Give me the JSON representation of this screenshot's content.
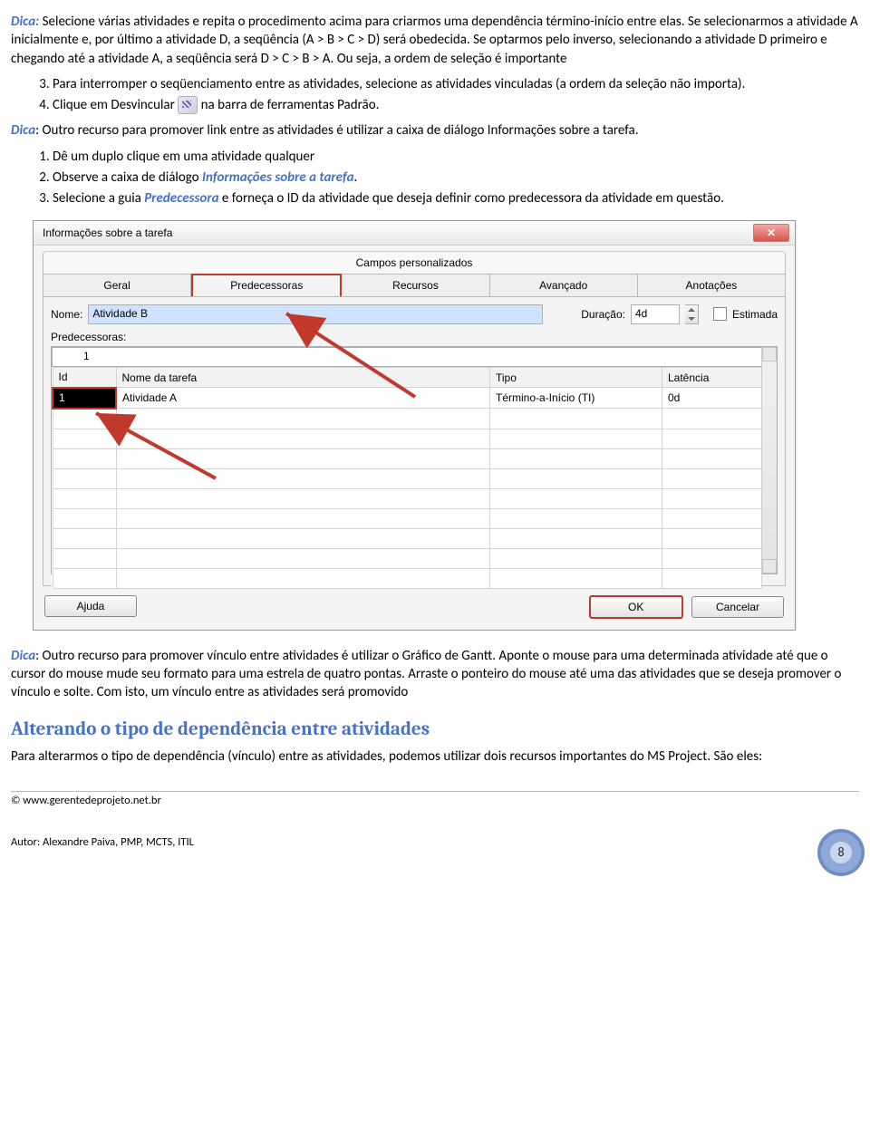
{
  "para1_prefix": "Dica:",
  "para1_body": " Selecione várias atividades e repita o procedimento acima para criarmos uma dependência término-início entre elas. Se selecionarmos a atividade A inicialmente e, por último a atividade D, a seqüência (A > B > C > D) será obedecida. Se optarmos pelo inverso, selecionando a atividade D primeiro e chegando até a atividade A, a seqüência será D > C > B > A. Ou seja, a ordem de seleção é importante",
  "ol1": {
    "i3": "Para interromper o seqüenciamento entre as atividades, selecione as atividades vinculadas (a ordem da seleção não importa).",
    "i4a": "Clique em Desvincular",
    "i4b": " na barra de ferramentas Padrão."
  },
  "para2_prefix": "Dica",
  "para2_body": ": Outro recurso para promover link entre as atividades é utilizar a caixa de diálogo Informações sobre a tarefa.",
  "ol2": {
    "i1": "Dê um duplo clique em uma atividade qualquer",
    "i2a": "Observe a caixa de diálogo ",
    "i2b": "Informações sobre a tarefa",
    "i2c": ".",
    "i3a": "Selecione a guia ",
    "i3b": "Predecessora",
    "i3c": " e forneça o ID da atividade que deseja definir como predecessora da atividade em questão."
  },
  "dialog": {
    "title": "Informações sobre a tarefa",
    "tabs_top": "Campos personalizados",
    "tabs": [
      "Geral",
      "Predecessoras",
      "Recursos",
      "Avançado",
      "Anotações"
    ],
    "nome_label": "Nome:",
    "nome_value": "Atividade B",
    "dur_label": "Duração:",
    "dur_value": "4d",
    "estimada": "Estimada",
    "predec_label": "Predecessoras:",
    "top_cell": "1",
    "cols": [
      "Id",
      "Nome da tarefa",
      "Tipo",
      "Latência"
    ],
    "row": {
      "id": "1",
      "nome": "Atividade A",
      "tipo": "Término-a-Início (TI)",
      "lat": "0d"
    },
    "btn_help": "Ajuda",
    "btn_ok": "OK",
    "btn_cancel": "Cancelar"
  },
  "para3_prefix": "Dica",
  "para3_body": ": Outro recurso para promover vínculo entre atividades é utilizar o Gráfico de Gantt. Aponte o mouse para uma determinada atividade até que o cursor do mouse mude seu formato para uma estrela de quatro pontas. Arraste o ponteiro do mouse até uma das atividades que se deseja promover o vínculo e solte. Com isto, um vínculo entre as atividades será promovido",
  "heading": "Alterando o tipo de dependência entre atividades",
  "para4": "Para alterarmos o tipo de dependência (vínculo) entre as atividades, podemos utilizar dois recursos importantes do MS Project. São eles:",
  "footer_site": "© www.gerentedeprojeto.net.br",
  "footer_author": "Autor: Alexandre Paiva, PMP, MCTS, ITIL",
  "page_num": "8"
}
